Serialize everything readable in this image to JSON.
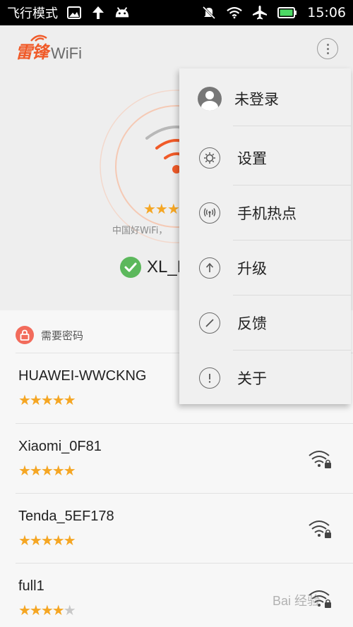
{
  "statusbar": {
    "mode_label": "飞行模式",
    "time": "15:06",
    "battery_color": "#4cd964"
  },
  "app": {
    "logo_cn": "雷锋",
    "logo_en": "WiFi",
    "brand_color": "#f05a28",
    "overflow_icon": "more-vertical-icon"
  },
  "hero": {
    "rating_stars": 3,
    "subtitle": "中国好WiFi，",
    "connected_ssid": "XL_M",
    "status_icon": "check-icon",
    "status_color": "#5cb85c"
  },
  "list": {
    "section_title": "需要密码",
    "section_icon": "lock-icon",
    "networks": [
      {
        "ssid": "HUAWEI-WWCKNG",
        "stars": 5,
        "icon": "wifi-locked-icon"
      },
      {
        "ssid": "Xiaomi_0F81",
        "stars": 5,
        "icon": "wifi-locked-icon"
      },
      {
        "ssid": "Tenda_5EF178",
        "stars": 5,
        "icon": "wifi-locked-icon"
      },
      {
        "ssid": "full1",
        "stars": 4,
        "icon": "wifi-locked-icon"
      }
    ]
  },
  "menu": {
    "items": [
      {
        "label": "未登录",
        "icon": "avatar-icon"
      },
      {
        "label": "设置",
        "icon": "gear-icon"
      },
      {
        "label": "手机热点",
        "icon": "hotspot-icon"
      },
      {
        "label": "升级",
        "icon": "arrow-up-icon"
      },
      {
        "label": "反馈",
        "icon": "pencil-icon"
      },
      {
        "label": "关于",
        "icon": "info-icon"
      }
    ]
  },
  "watermark": "Bai 经验"
}
